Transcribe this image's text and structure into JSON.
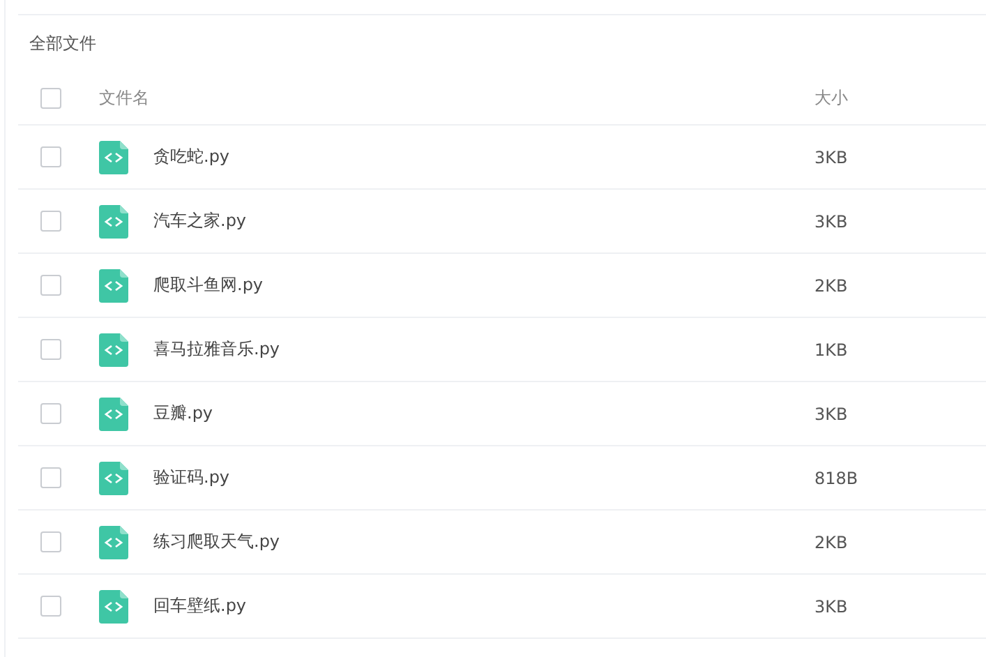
{
  "breadcrumb": "全部文件",
  "table": {
    "columns": [
      "文件名",
      "大小"
    ],
    "header_checked": false,
    "rows": [
      {
        "name": "贪吃蛇.py",
        "size": "3KB",
        "checked": false
      },
      {
        "name": "汽车之家.py",
        "size": "3KB",
        "checked": false
      },
      {
        "name": "爬取斗鱼网.py",
        "size": "2KB",
        "checked": false
      },
      {
        "name": "喜马拉雅音乐.py",
        "size": "1KB",
        "checked": false
      },
      {
        "name": "豆瓣.py",
        "size": "3KB",
        "checked": false
      },
      {
        "name": "验证码.py",
        "size": "818B",
        "checked": false
      },
      {
        "name": "练习爬取天气.py",
        "size": "2KB",
        "checked": false
      },
      {
        "name": "回车壁纸.py",
        "size": "3KB",
        "checked": false
      }
    ]
  }
}
